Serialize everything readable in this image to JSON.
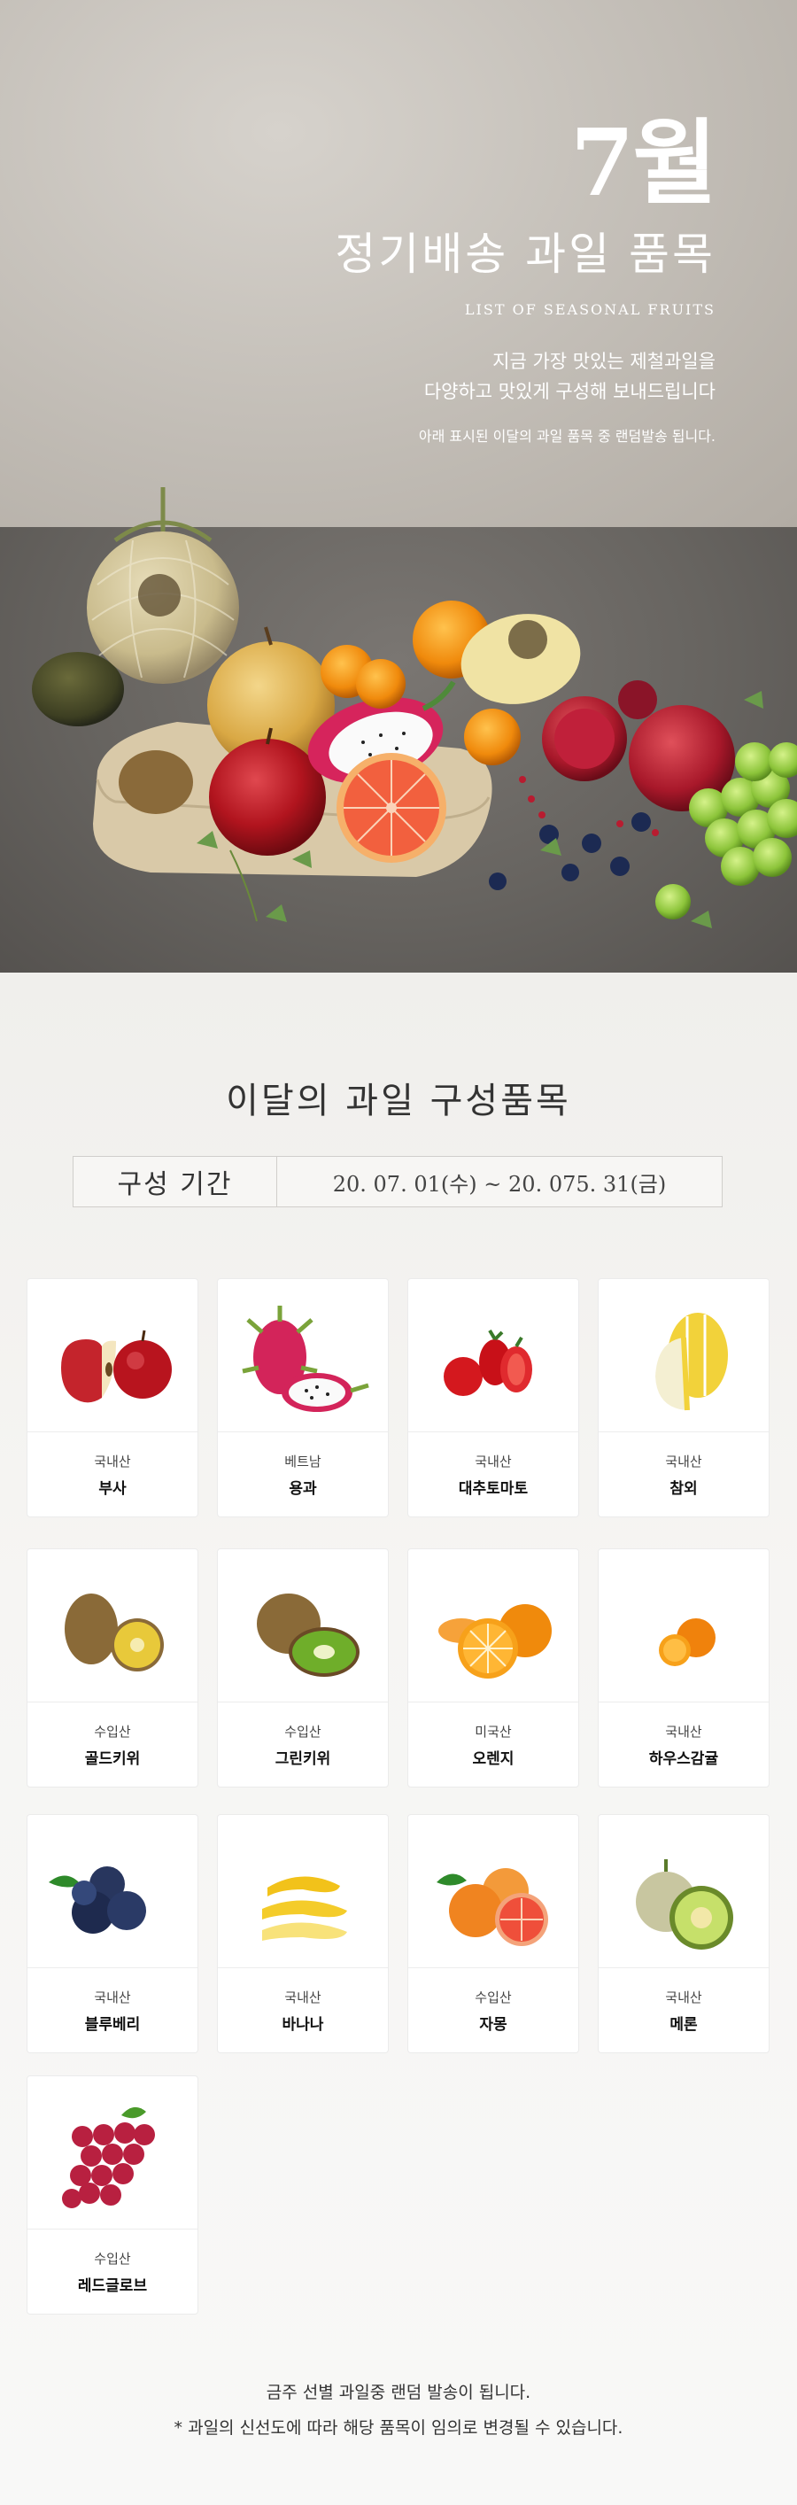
{
  "hero": {
    "month": "7월",
    "title": "정기배송 과일 품목",
    "subtitle_en": "LIST OF SEASONAL FRUITS",
    "copy_line1": "지금 가장 맛있는 제철과일을",
    "copy_line2": "다양하고 맛있게 구성해 보내드립니다",
    "note": "아래 표시된 이달의 과일 품목 중 랜덤발송 됩니다."
  },
  "section": {
    "title": "이달의 과일 구성품목",
    "period_label": "구성 기간",
    "period_value": "20. 07. 01(수) ~ 20. 075. 31(금)"
  },
  "fruits": [
    {
      "origin": "국내산",
      "name": "부사",
      "icon": "apple-icon"
    },
    {
      "origin": "베트남",
      "name": "용과",
      "icon": "dragonfruit-icon"
    },
    {
      "origin": "국내산",
      "name": "대추토마토",
      "icon": "cherry-tomato-icon"
    },
    {
      "origin": "국내산",
      "name": "참외",
      "icon": "korean-melon-icon"
    },
    {
      "origin": "수입산",
      "name": "골드키위",
      "icon": "gold-kiwi-icon"
    },
    {
      "origin": "수입산",
      "name": "그린키위",
      "icon": "green-kiwi-icon"
    },
    {
      "origin": "미국산",
      "name": "오렌지",
      "icon": "orange-icon"
    },
    {
      "origin": "국내산",
      "name": "하우스감귤",
      "icon": "tangerine-icon"
    },
    {
      "origin": "국내산",
      "name": "블루베리",
      "icon": "blueberry-icon"
    },
    {
      "origin": "국내산",
      "name": "바나나",
      "icon": "banana-icon"
    },
    {
      "origin": "수입산",
      "name": "자몽",
      "icon": "grapefruit-icon"
    },
    {
      "origin": "국내산",
      "name": "메론",
      "icon": "melon-icon"
    },
    {
      "origin": "수입산",
      "name": "레드글로브",
      "icon": "red-globe-grape-icon"
    }
  ],
  "footer": {
    "line1": "금주 선별 과일중 랜덤 발송이 됩니다.",
    "line2": "* 과일의 신선도에 따라 해당 품목이 임의로 변경될 수 있습니다."
  }
}
